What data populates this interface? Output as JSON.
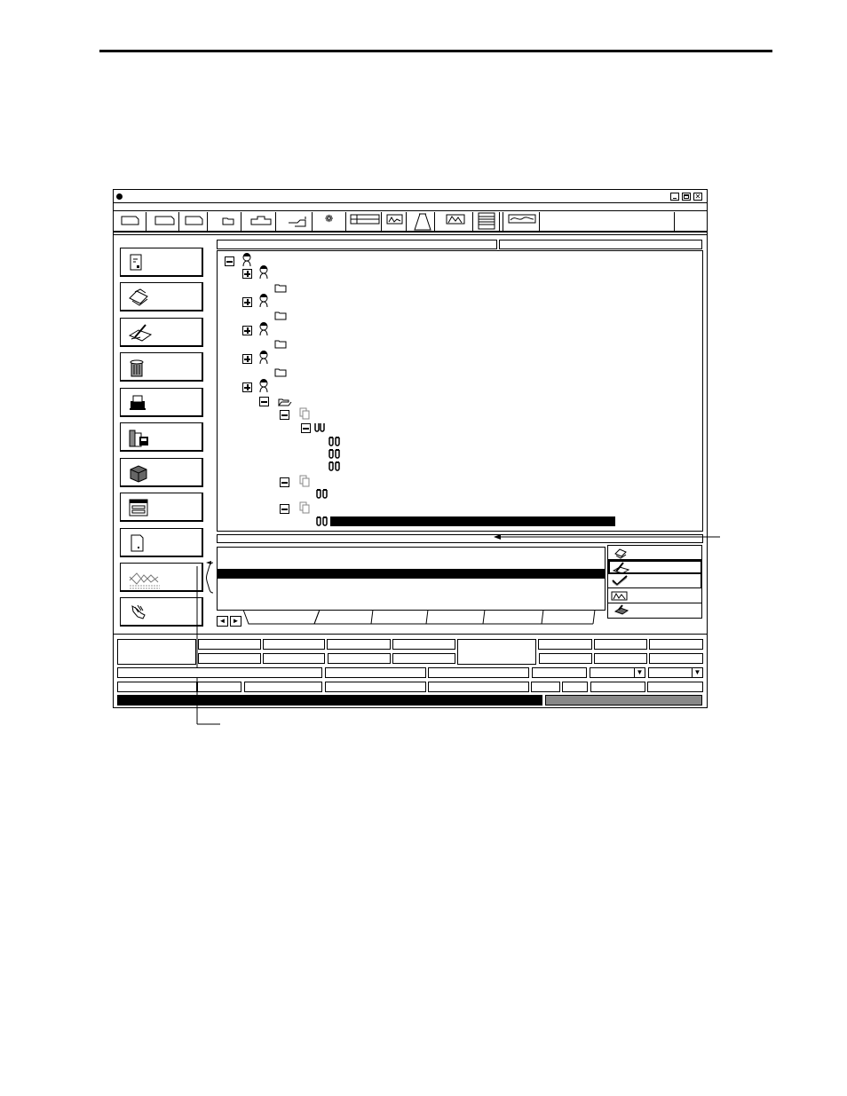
{
  "header_rule": {},
  "window": {
    "title": "",
    "controls": [
      "minimize-icon",
      "maximize-icon",
      "close-icon"
    ]
  },
  "toolbar": {
    "icons": [
      "new-document-icon",
      "new-document-icon",
      "new-document-icon",
      "open-folder-icon",
      "tray-icon",
      "hand-pointer-icon",
      "gear-icon",
      "table-icon",
      "waveform-icon",
      "flask-icon",
      "chart-icon",
      "list-icon",
      "graph-icon"
    ]
  },
  "sidebar": {
    "icons": [
      "document-icon",
      "printer-icon",
      "signature-icon",
      "trash-icon",
      "printer-output-icon",
      "archive-icon",
      "package-icon",
      "window-icon",
      "page-icon",
      "chart-trend-icon",
      "hand-icon"
    ]
  },
  "tree": {
    "highlighted_row_text": ""
  },
  "right_panel": {
    "icons": [
      "printer-icon",
      "signature-icon",
      "checkmark-icon",
      "waveform-icon",
      "stamp-icon"
    ]
  },
  "footer": {
    "dropdown_arrow": "▼"
  },
  "nav": {
    "prev": "◄",
    "next": "►"
  }
}
